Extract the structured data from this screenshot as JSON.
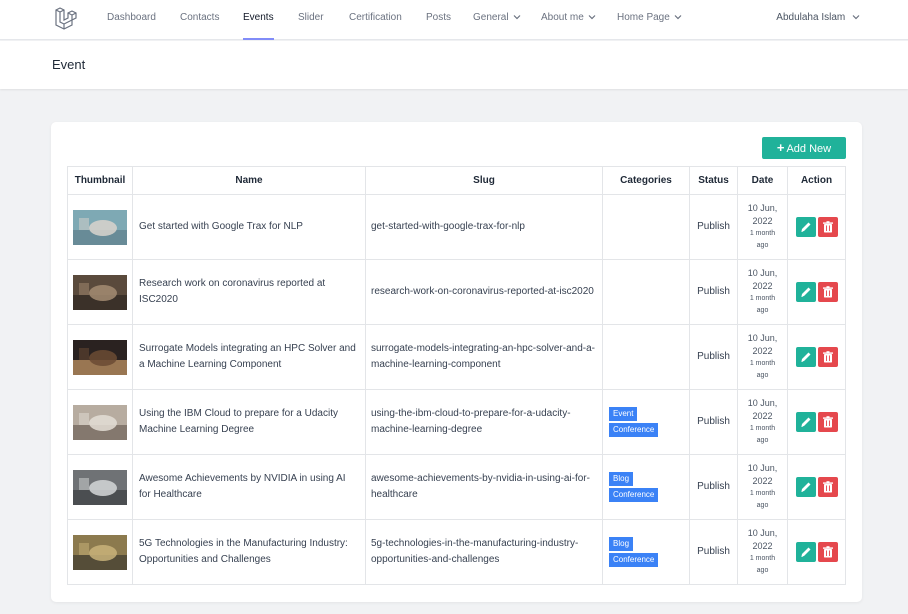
{
  "nav": {
    "items": [
      {
        "label": "Dashboard",
        "active": false,
        "dropdown": false
      },
      {
        "label": "Contacts",
        "active": false,
        "dropdown": false
      },
      {
        "label": "Events",
        "active": true,
        "dropdown": false
      },
      {
        "label": "Slider",
        "active": false,
        "dropdown": false
      },
      {
        "label": "Certification",
        "active": false,
        "dropdown": false
      },
      {
        "label": "Posts",
        "active": false,
        "dropdown": false
      },
      {
        "label": "General",
        "active": false,
        "dropdown": true
      },
      {
        "label": "About me",
        "active": false,
        "dropdown": true
      },
      {
        "label": "Home Page",
        "active": false,
        "dropdown": true
      }
    ],
    "user": "Abdulaha Islam"
  },
  "header": {
    "title": "Event"
  },
  "toolbar": {
    "add_label": "Add New"
  },
  "table": {
    "headers": [
      "Thumbnail",
      "Name",
      "Slug",
      "Categories",
      "Status",
      "Date",
      "Action"
    ],
    "rows": [
      {
        "name": "Get started with Google Trax for NLP",
        "slug": "get-started-with-google-trax-for-nlp",
        "categories": [],
        "status": "Publish",
        "date1": "10 Jun,",
        "date2": "2022",
        "ago1": "1 month",
        "ago2": "ago"
      },
      {
        "name": "Research work on coronavirus reported at ISC2020",
        "slug": "research-work-on-coronavirus-reported-at-isc2020",
        "categories": [],
        "status": "Publish",
        "date1": "10 Jun,",
        "date2": "2022",
        "ago1": "1 month",
        "ago2": "ago"
      },
      {
        "name": "Surrogate Models integrating an HPC Solver and a Machine Learning Component",
        "slug": "surrogate-models-integrating-an-hpc-solver-and-a-machine-learning-component",
        "categories": [],
        "status": "Publish",
        "date1": "10 Jun,",
        "date2": "2022",
        "ago1": "1 month",
        "ago2": "ago"
      },
      {
        "name": "Using the IBM Cloud to prepare for a Udacity Machine Learning Degree",
        "slug": "using-the-ibm-cloud-to-prepare-for-a-udacity-machine-learning-degree",
        "categories": [
          "Event",
          "Conference"
        ],
        "status": "Publish",
        "date1": "10 Jun,",
        "date2": "2022",
        "ago1": "1 month",
        "ago2": "ago"
      },
      {
        "name": "Awesome Achievements by NVIDIA in using AI for Healthcare",
        "slug": "awesome-achievements-by-nvidia-in-using-ai-for-healthcare",
        "categories": [
          "Blog",
          "Conference"
        ],
        "status": "Publish",
        "date1": "10 Jun,",
        "date2": "2022",
        "ago1": "1 month",
        "ago2": "ago"
      },
      {
        "name": "5G Technologies in the Manufacturing Industry: Opportunities and Challenges",
        "slug": "5g-technologies-in-the-manufacturing-industry-opportunities-and-challenges",
        "categories": [
          "Blog",
          "Conference"
        ],
        "status": "Publish",
        "date1": "10 Jun,",
        "date2": "2022",
        "ago1": "1 month",
        "ago2": "ago"
      }
    ]
  },
  "colors": {
    "accent": "#20b29a",
    "danger": "#e5484d",
    "badge": "#3b82f6",
    "nav_active": "#818cf8"
  }
}
